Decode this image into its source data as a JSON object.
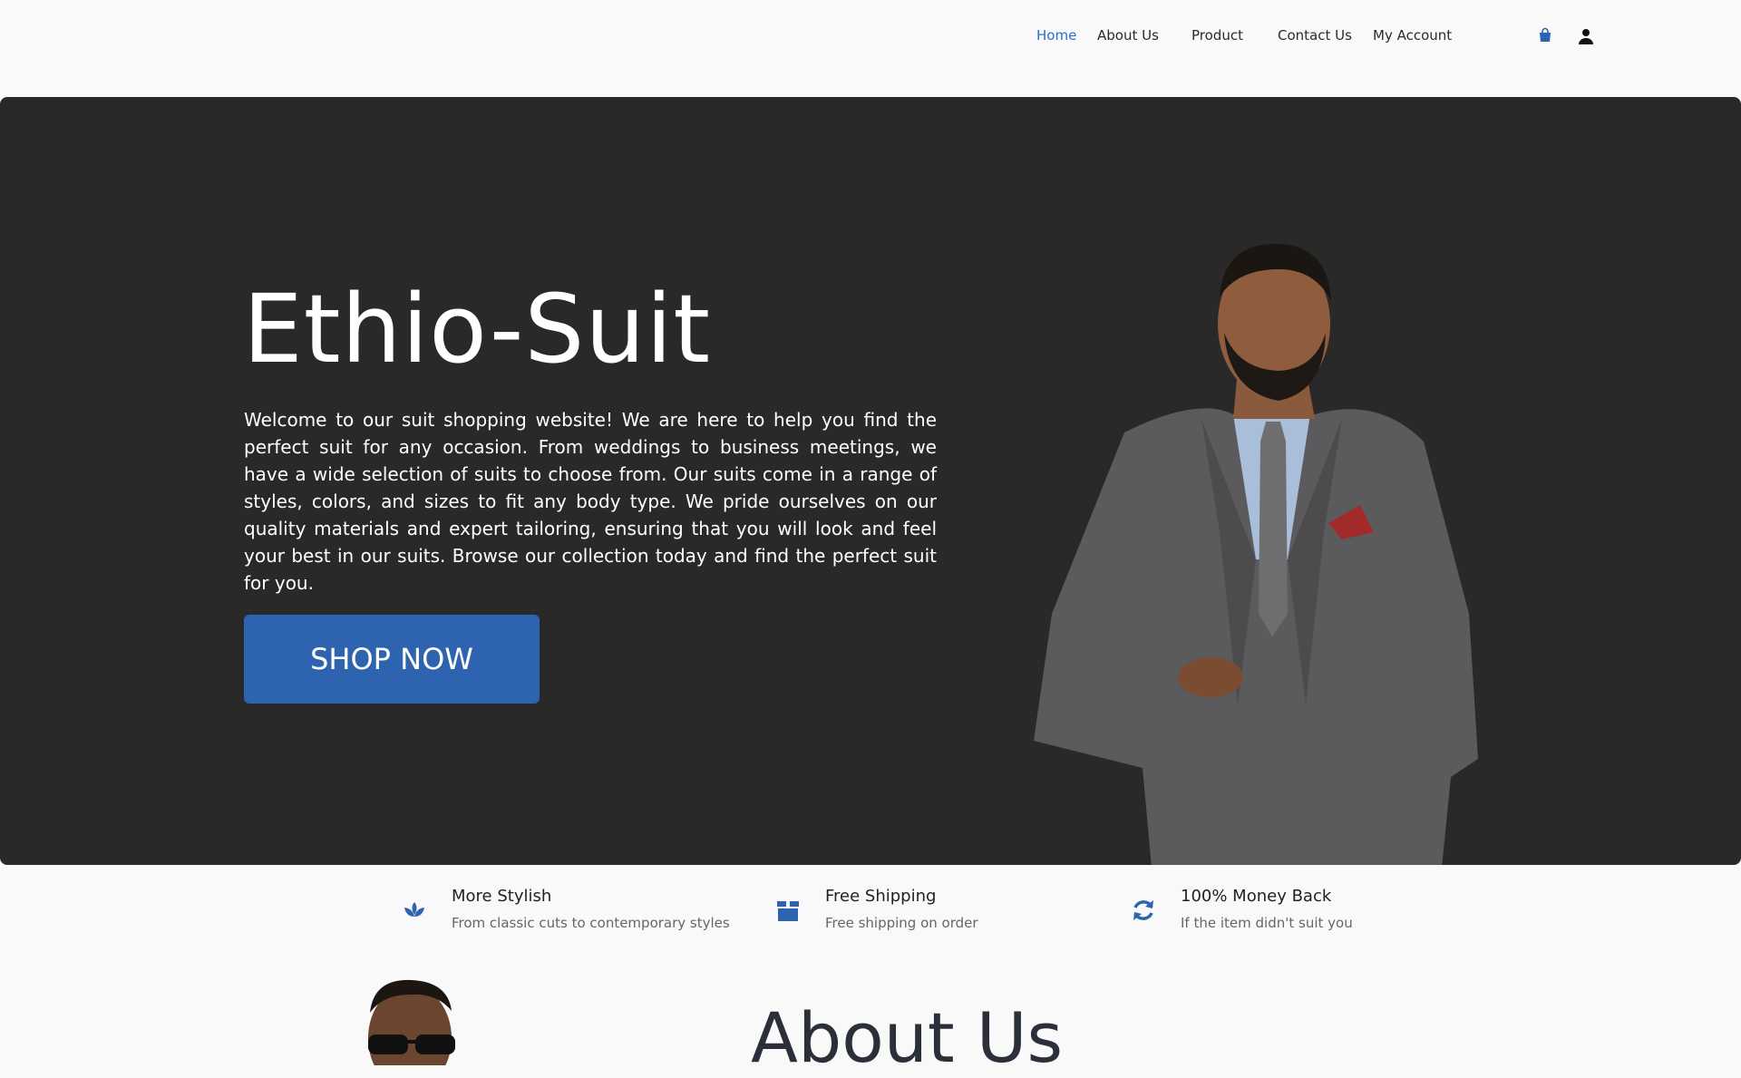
{
  "nav": {
    "links": [
      {
        "label": "Home",
        "active": true
      },
      {
        "label": "About Us"
      },
      {
        "label": "Product"
      },
      {
        "label": "Contact Us"
      },
      {
        "label": "My Account"
      }
    ],
    "icons": [
      "shopping-bag-icon",
      "user-icon"
    ]
  },
  "hero": {
    "title": "Ethio-Suit",
    "text": "Welcome to our suit shopping website! We are here to help you find the perfect suit for any occasion. From weddings to business meetings, we have a wide selection of suits to choose from. Our suits come in a range of styles, colors, and sizes to fit any body type. We pride ourselves on our quality materials and expert tailoring, ensuring that you will look and feel your best in our suits. Browse our collection today and find the perfect suit for you.",
    "button": "SHOP NOW"
  },
  "features": [
    {
      "title": "More Stylish",
      "subtitle": "From classic cuts to contemporary styles",
      "icon": "lotus-icon"
    },
    {
      "title": "Free Shipping",
      "subtitle": "Free shipping on order",
      "icon": "box-icon"
    },
    {
      "title": "100% Money Back",
      "subtitle": "If the item didn't suit you",
      "icon": "refresh-icon"
    }
  ],
  "about": {
    "heading": "About Us"
  },
  "colors": {
    "accent": "#2e63b0",
    "hero_bg": "#292929",
    "page_bg": "#f9f9f9",
    "nav_active": "#2b6cd4"
  }
}
